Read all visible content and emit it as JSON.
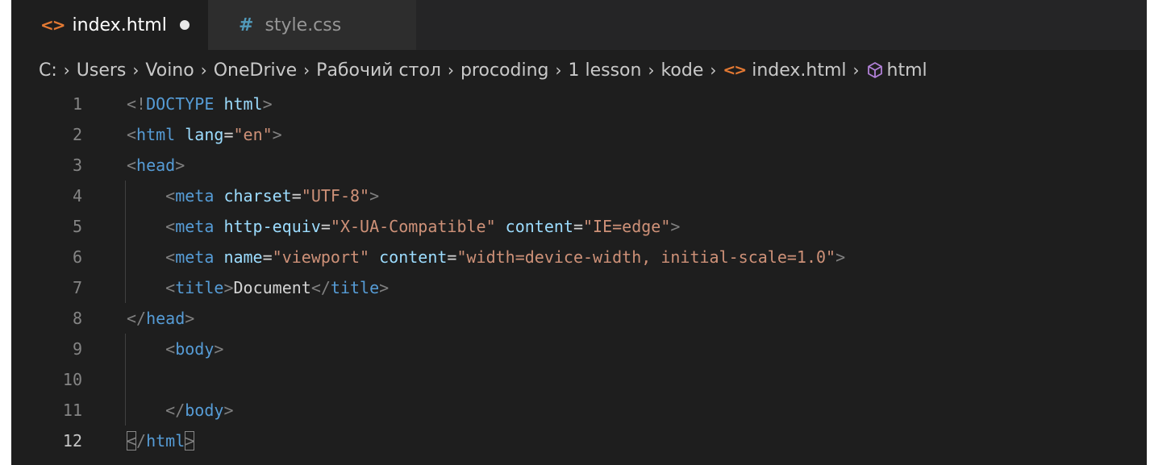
{
  "tabs": [
    {
      "label": "index.html",
      "icon": "html-file-icon",
      "active": true,
      "dirty": true
    },
    {
      "label": "style.css",
      "icon": "css-file-icon",
      "active": false,
      "dirty": false
    }
  ],
  "breadcrumb": [
    "C:",
    "Users",
    "Voino",
    "OneDrive",
    "Рабочий стол",
    "procoding",
    "1 lesson",
    "kode",
    "index.html",
    "html"
  ],
  "icons": {
    "html_glyph": "<>",
    "css_glyph": "#",
    "separator": "›"
  },
  "code": {
    "current_line": 12,
    "lines": [
      {
        "n": "1",
        "text": "<!DOCTYPE html>"
      },
      {
        "n": "2",
        "text": "<html lang=\"en\">"
      },
      {
        "n": "3",
        "text": "<head>"
      },
      {
        "n": "4",
        "text": "    <meta charset=\"UTF-8\">"
      },
      {
        "n": "5",
        "text": "    <meta http-equiv=\"X-UA-Compatible\" content=\"IE=edge\">"
      },
      {
        "n": "6",
        "text": "    <meta name=\"viewport\" content=\"width=device-width, initial-scale=1.0\">"
      },
      {
        "n": "7",
        "text": "    <title>Document</title>"
      },
      {
        "n": "8",
        "text": "</head>"
      },
      {
        "n": "9",
        "text": "    <body>"
      },
      {
        "n": "10",
        "text": ""
      },
      {
        "n": "11",
        "text": "    </body>"
      },
      {
        "n": "12",
        "text": "</html>"
      }
    ]
  },
  "colors": {
    "background": "#1e1e1e",
    "tag": "#569cd6",
    "attribute": "#9cdcfe",
    "string": "#ce9178",
    "bracket": "#808080",
    "html_icon": "#e37933",
    "css_icon": "#519aba"
  }
}
